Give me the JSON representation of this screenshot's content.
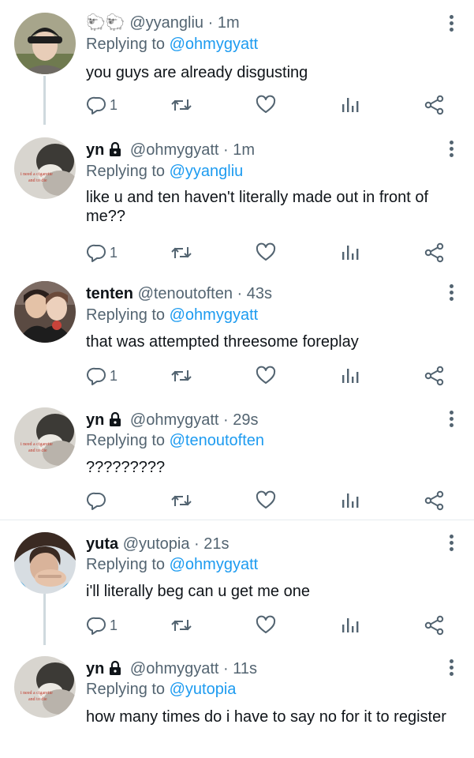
{
  "tweets": [
    {
      "name": "",
      "emoji": "🐑🐑",
      "handle": "@yyangliu",
      "dot": "·",
      "time": "1m",
      "replying_prefix": "Replying to",
      "replying_to": "@ohmygyatt",
      "text": "you guys are already disgusting",
      "reply_count": "1",
      "has_lock": false
    },
    {
      "name": "yn",
      "emoji": "",
      "handle": "@ohmygyatt",
      "dot": "·",
      "time": "1m",
      "replying_prefix": "Replying to",
      "replying_to": "@yyangliu",
      "text": "like u and ten haven't literally made out in front of me??",
      "reply_count": "1",
      "has_lock": true
    },
    {
      "name": "tenten",
      "emoji": "",
      "handle": "@tenoutoften",
      "dot": "·",
      "time": "43s",
      "replying_prefix": "Replying to",
      "replying_to": "@ohmygyatt",
      "text": "that was attempted threesome foreplay",
      "reply_count": "1",
      "has_lock": false
    },
    {
      "name": "yn",
      "emoji": "",
      "handle": "@ohmygyatt",
      "dot": "·",
      "time": "29s",
      "replying_prefix": "Replying to",
      "replying_to": "@tenoutoften",
      "text": "?????????",
      "reply_count": "",
      "has_lock": true
    },
    {
      "name": "yuta",
      "emoji": "",
      "handle": "@yutopia",
      "dot": "·",
      "time": "21s",
      "replying_prefix": "Replying to",
      "replying_to": "@ohmygyatt",
      "text": "i'll literally beg can u get me one",
      "reply_count": "1",
      "has_lock": false
    },
    {
      "name": "yn",
      "emoji": "",
      "handle": "@ohmygyatt",
      "dot": "·",
      "time": "11s",
      "replying_prefix": "Replying to",
      "replying_to": "@yutopia",
      "text": "how many times do i have to say no for it to register",
      "reply_count": "",
      "has_lock": true
    }
  ],
  "avatar_text": {
    "line1": "i need a cigarette",
    "line2": "and to die"
  },
  "icons": [
    "reply-icon",
    "retweet-icon",
    "like-icon",
    "analytics-icon",
    "share-icon",
    "more-menu-icon",
    "lock-icon"
  ],
  "colors": {
    "text": "#0f1419",
    "secondary": "#536471",
    "link": "#1d9bf0",
    "thread": "#cfd9de",
    "divider": "#e6ecf0"
  }
}
